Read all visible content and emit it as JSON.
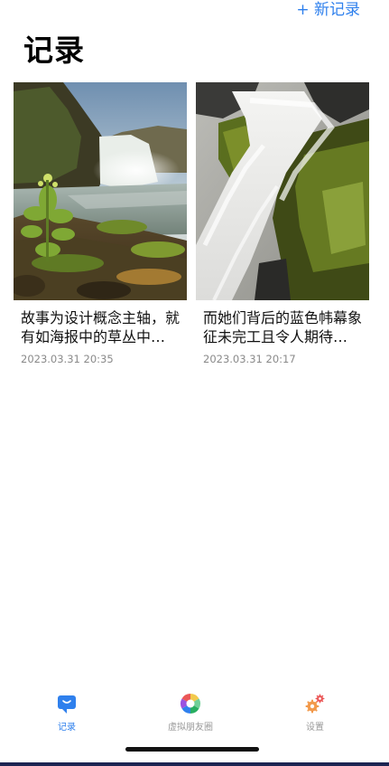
{
  "header": {
    "new_record_label": "+ 新记录",
    "title": "记录"
  },
  "records": [
    {
      "title": "故事为设计概念主轴，就有如海报中的草丛中的小花",
      "time": "2023.03.31 20:35",
      "image": "waterfall-landscape-photo"
    },
    {
      "title": "而她们背后的蓝色帏幕象征未完工且令人期待的未来",
      "time": "2023.03.31 20:17",
      "image": "waterfall-closeup-photo"
    }
  ],
  "tabs": [
    {
      "label": "记录",
      "icon": "message-icon",
      "active": true
    },
    {
      "label": "虚拟朋友圈",
      "icon": "aperture-icon",
      "active": false
    },
    {
      "label": "设置",
      "icon": "gear-icon",
      "active": false
    }
  ],
  "colors": {
    "accent": "#2f80ed",
    "inactive_label": "#9a9a9a",
    "timestamp": "#8a8a8a"
  }
}
